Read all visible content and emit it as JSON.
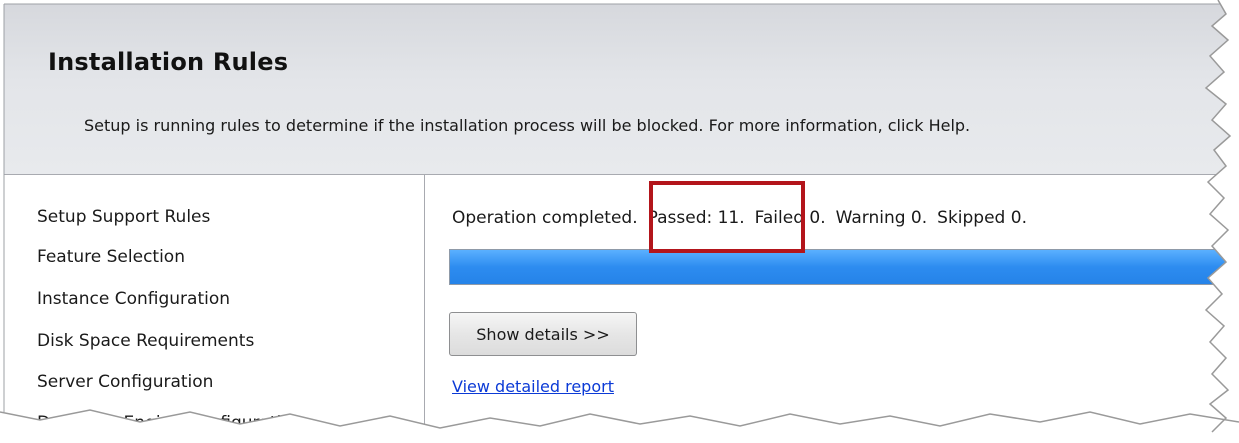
{
  "header": {
    "title": "Installation Rules",
    "description": "Setup is running rules to determine if the installation process will be blocked. For more information, click Help."
  },
  "sidebar": {
    "items": [
      {
        "label": "Setup Support Rules"
      },
      {
        "label": "Feature Selection"
      },
      {
        "label": "Instance Configuration"
      },
      {
        "label": "Disk Space Requirements"
      },
      {
        "label": "Server Configuration"
      },
      {
        "label": "Database Engine Configuration"
      }
    ]
  },
  "main": {
    "status": {
      "operation": "Operation completed.",
      "passed": "Passed: 11.",
      "failed": "Failed 0.",
      "warning": "Warning 0.",
      "skipped": "Skipped 0."
    },
    "progress_percent": 100,
    "show_details_label": "Show details >>",
    "view_report_label": "View detailed report"
  },
  "colors": {
    "progress": "#2d8cf0",
    "highlight": "#b3151b",
    "link": "#0b3ad6"
  }
}
